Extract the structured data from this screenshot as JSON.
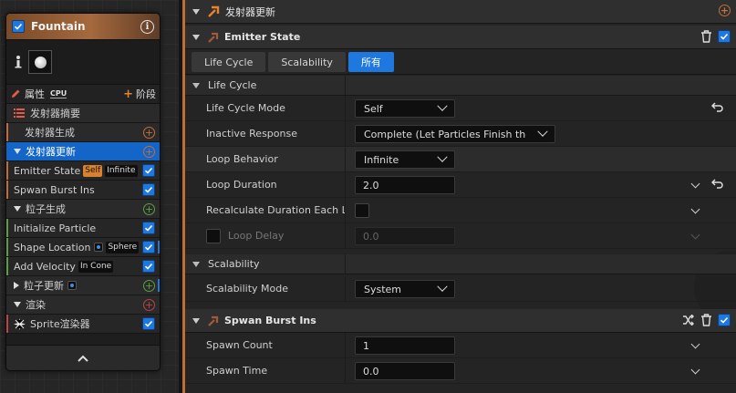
{
  "node": {
    "title": "Fountain",
    "toolbar": {
      "attributes_label": "属性",
      "cpu_label": "CPU",
      "stage_label": "阶段"
    },
    "rows": [
      {
        "label": "发射器摘要"
      },
      {
        "label": "发射器生成"
      },
      {
        "label": "发射器更新"
      },
      {
        "label": "Emitter State",
        "badge1": "Self",
        "badge2": "Infinite"
      },
      {
        "label": "Spwan Burst Ins"
      },
      {
        "label": "粒子生成"
      },
      {
        "label": "Initialize Particle"
      },
      {
        "label": "Shape Location",
        "badge": "Sphere"
      },
      {
        "label": "Add Velocity",
        "badge": "In Cone"
      },
      {
        "label": "粒子更新"
      },
      {
        "label": "渲染"
      },
      {
        "label": "Sprite渲染器"
      }
    ]
  },
  "details": {
    "top_header": "发射器更新",
    "emitter_state": {
      "title": "Emitter State",
      "tabs": [
        "Life Cycle",
        "Scalability",
        "所有"
      ],
      "active_tab": "所有",
      "lifecycle_category": "Life Cycle",
      "props": [
        {
          "name": "Life Cycle Mode",
          "value": "Self"
        },
        {
          "name": "Inactive Response",
          "value": "Complete (Let Particles Finish then"
        },
        {
          "name": "Loop Behavior",
          "value": "Infinite"
        },
        {
          "name": "Loop Duration",
          "value": "2.0"
        },
        {
          "name": "Recalculate Duration Each Loc",
          "value": ""
        },
        {
          "name": "Loop Delay",
          "value": "0.0"
        }
      ],
      "scalability_category": "Scalability",
      "scalability_mode": {
        "name": "Scalability Mode",
        "value": "System"
      }
    },
    "spawn_burst": {
      "title": "Spwan Burst Ins",
      "props": [
        {
          "name": "Spawn Count",
          "value": "1"
        },
        {
          "name": "Spawn Time",
          "value": "0.0"
        }
      ]
    }
  },
  "colors": {
    "accent_blue": "#1f78e0",
    "emitter_orange": "#c06e33",
    "selected_row": "#1365c8"
  }
}
